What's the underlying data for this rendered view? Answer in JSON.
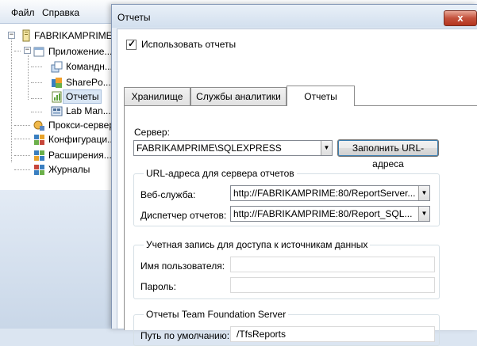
{
  "menu": {
    "file": "Файл",
    "help": "Справка"
  },
  "tree": {
    "root": "FABRIKAMPRIME",
    "applications": "Приложение...",
    "team": "Командн...",
    "sharepoint": "SharePo...",
    "reports": "Отчеты",
    "lab": "Lab Man...",
    "proxy": "Прокси-сервер",
    "configuration": "Конфигураци...",
    "extensions": "Расширения...",
    "logs": "Журналы"
  },
  "dialog": {
    "title": "Отчеты",
    "close": "x",
    "use_reports_label": "Использовать отчеты",
    "use_reports_checked": true,
    "tabs": [
      "Хранилище",
      "Службы аналитики",
      "Отчеты"
    ],
    "active_tab": "Отчеты",
    "server_label": "Сервер:",
    "server_value": "FABRIKAMPRIME\\SQLEXPRESS",
    "fill_urls_button": "Заполнить URL-адреса",
    "urls_group": "URL-адреса для сервера отчетов",
    "web_service_label": "Веб-служба:",
    "web_service_value": "http://FABRIKAMPRIME:80/ReportServer...",
    "report_manager_label": "Диспетчер отчетов:",
    "report_manager_value": "http://FABRIKAMPRIME:80/Report_SQL...",
    "account_group": "Учетная запись для доступа к источникам данных",
    "username_label": "Имя пользователя:",
    "username_value": "",
    "password_label": "Пароль:",
    "password_value": "",
    "tfs_group": "Отчеты Team Foundation Server",
    "default_path_label": "Путь по умолчанию:",
    "default_path_value": "/TfsReports"
  },
  "colors": {
    "accent": "#3c7fb1",
    "close": "#c4513c"
  }
}
